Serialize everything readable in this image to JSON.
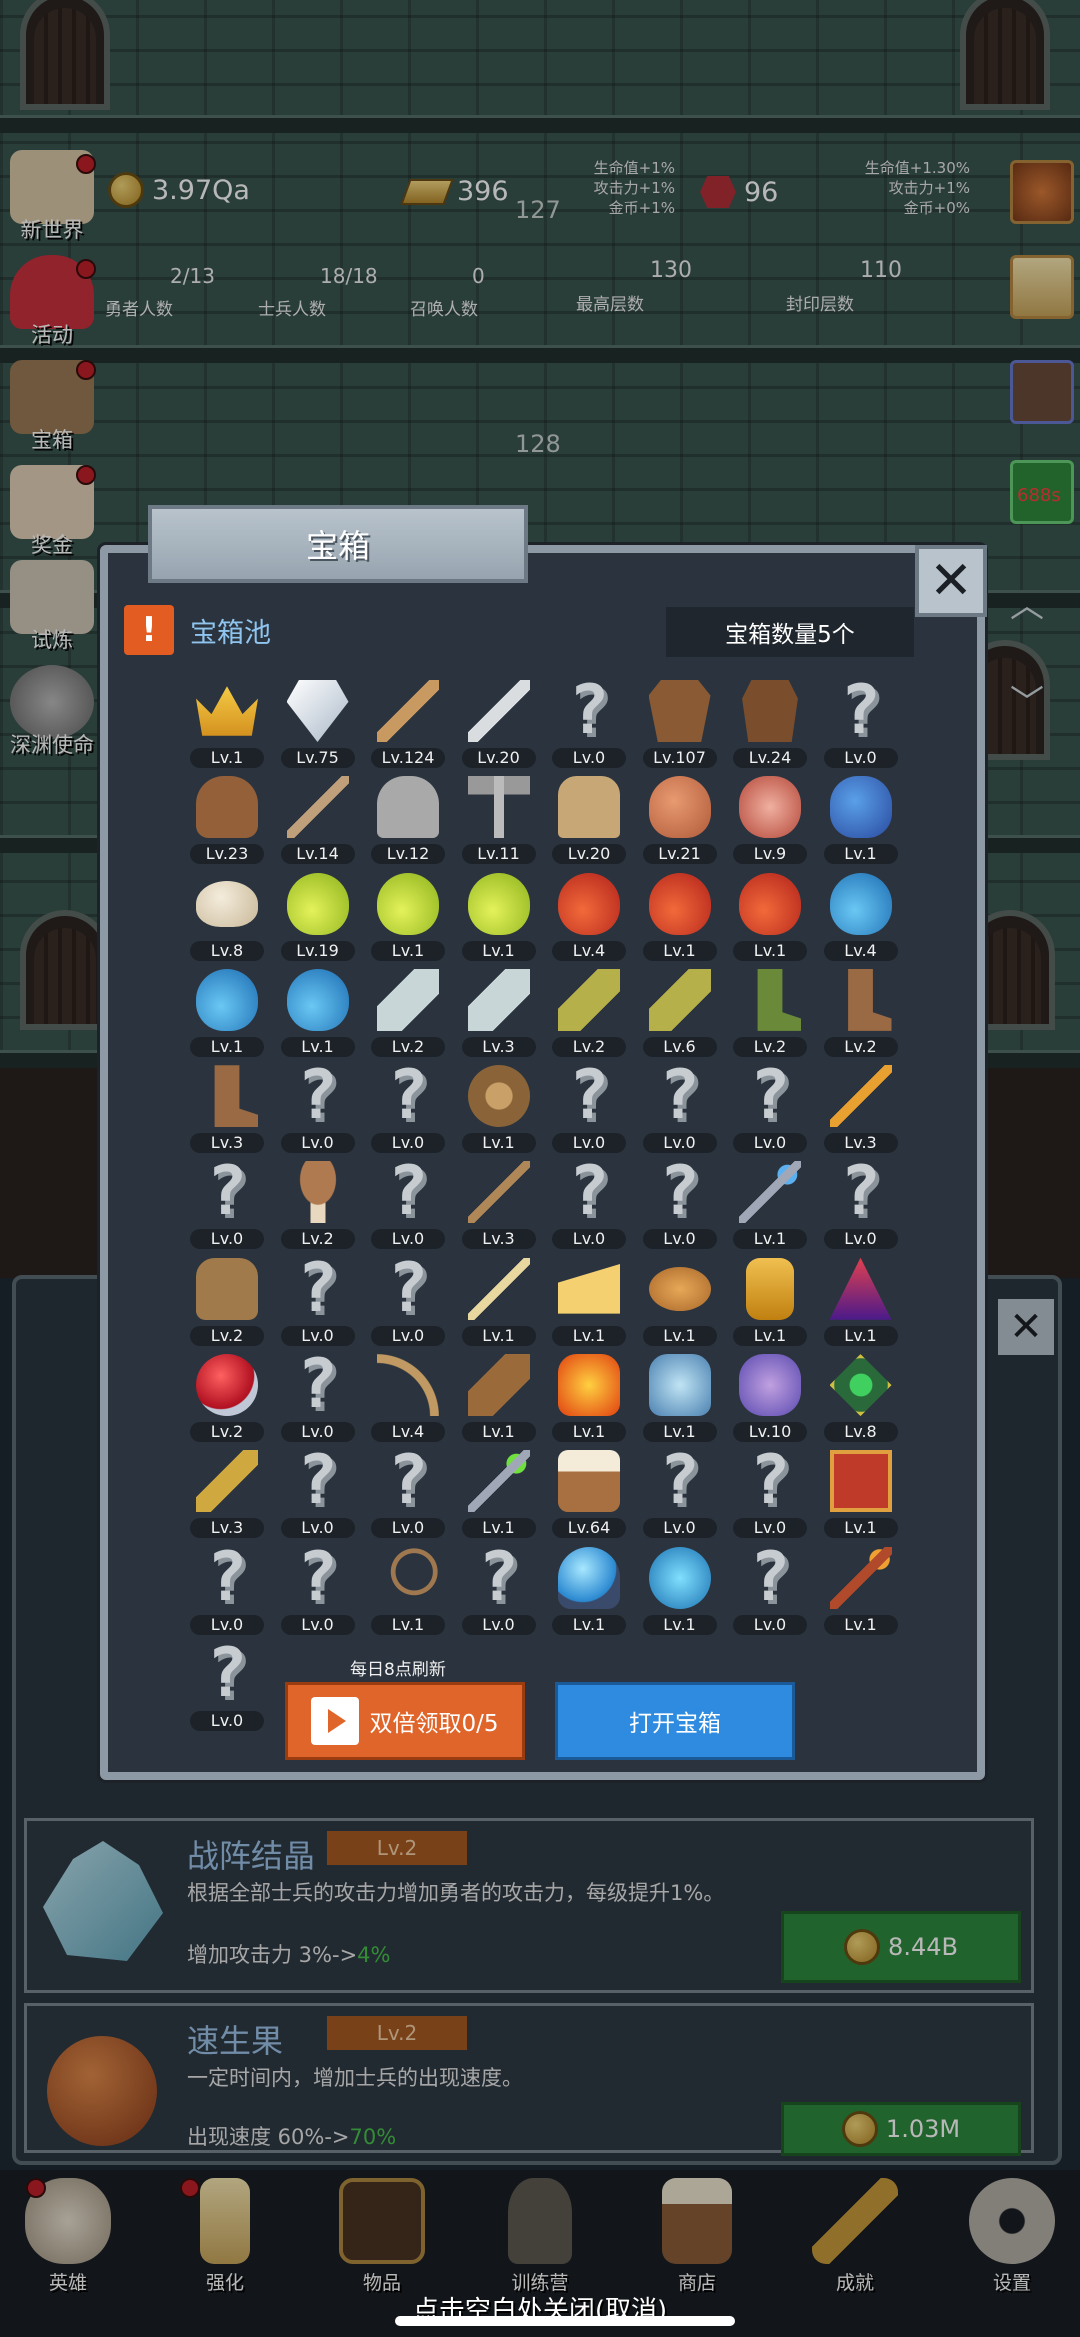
{
  "hud": {
    "gold": "3.97Qa",
    "bars": "396",
    "gems": "96",
    "mid_num": "127",
    "floor_num": "128",
    "timer": "688s",
    "buff_left": [
      "生命值+1%",
      "攻击力+1%",
      "金币+1%"
    ],
    "buff_right": [
      "生命值+1.30%",
      "攻击力+1%",
      "金币+0%"
    ],
    "stats": [
      {
        "value": "2/13",
        "label": "勇者人数"
      },
      {
        "value": "18/18",
        "label": "士兵人数"
      },
      {
        "value": "0",
        "label": "召唤人数"
      },
      {
        "value": "130",
        "label": "最高层数"
      },
      {
        "value": "110",
        "label": "封印层数"
      }
    ]
  },
  "side_menu": [
    "新世界",
    "活动",
    "宝箱",
    "奖金",
    "试炼",
    "深渊使命"
  ],
  "modal": {
    "title": "宝箱",
    "pool_title": "宝箱池",
    "chest_count": "宝箱数量5个",
    "refresh_note": "每日8点刷新",
    "double_claim": "双倍领取0/5",
    "open_chest": "打开宝箱",
    "items": [
      {
        "icon": "crown",
        "lv": "Lv.1"
      },
      {
        "icon": "diamond",
        "lv": "Lv.75"
      },
      {
        "icon": "wooden-sword",
        "lv": "Lv.124"
      },
      {
        "icon": "iron-sword",
        "lv": "Lv.20"
      },
      {
        "icon": "unknown",
        "lv": "Lv.0"
      },
      {
        "icon": "leather-armor",
        "lv": "Lv.107"
      },
      {
        "icon": "vest",
        "lv": "Lv.24"
      },
      {
        "icon": "unknown",
        "lv": "Lv.0"
      },
      {
        "icon": "leather-helmet",
        "lv": "Lv.23"
      },
      {
        "icon": "dagger",
        "lv": "Lv.14"
      },
      {
        "icon": "knight-helmet",
        "lv": "Lv.12"
      },
      {
        "icon": "hammer",
        "lv": "Lv.11"
      },
      {
        "icon": "great-helm",
        "lv": "Lv.20"
      },
      {
        "icon": "ham",
        "lv": "Lv.21"
      },
      {
        "icon": "steak",
        "lv": "Lv.9"
      },
      {
        "icon": "blue-sack",
        "lv": "Lv.1"
      },
      {
        "icon": "bread",
        "lv": "Lv.8"
      },
      {
        "icon": "yellow-potion",
        "lv": "Lv.19"
      },
      {
        "icon": "yellow-potion",
        "lv": "Lv.1"
      },
      {
        "icon": "yellow-potion",
        "lv": "Lv.1"
      },
      {
        "icon": "red-potion",
        "lv": "Lv.4"
      },
      {
        "icon": "red-potion",
        "lv": "Lv.1"
      },
      {
        "icon": "red-potion",
        "lv": "Lv.1"
      },
      {
        "icon": "blue-potion",
        "lv": "Lv.4"
      },
      {
        "icon": "blue-potion",
        "lv": "Lv.1"
      },
      {
        "icon": "blue-potion",
        "lv": "Lv.1"
      },
      {
        "icon": "bottle",
        "lv": "Lv.2"
      },
      {
        "icon": "bottle",
        "lv": "Lv.3"
      },
      {
        "icon": "wine-bottle",
        "lv": "Lv.2"
      },
      {
        "icon": "wine-bottle",
        "lv": "Lv.6"
      },
      {
        "icon": "winged-boot",
        "lv": "Lv.2"
      },
      {
        "icon": "boot",
        "lv": "Lv.2"
      },
      {
        "icon": "boot",
        "lv": "Lv.3"
      },
      {
        "icon": "unknown",
        "lv": "Lv.0"
      },
      {
        "icon": "unknown",
        "lv": "Lv.0"
      },
      {
        "icon": "round-shield",
        "lv": "Lv.1"
      },
      {
        "icon": "unknown",
        "lv": "Lv.0"
      },
      {
        "icon": "unknown",
        "lv": "Lv.0"
      },
      {
        "icon": "unknown",
        "lv": "Lv.0"
      },
      {
        "icon": "torch",
        "lv": "Lv.3"
      },
      {
        "icon": "unknown",
        "lv": "Lv.0"
      },
      {
        "icon": "mushroom",
        "lv": "Lv.2"
      },
      {
        "icon": "unknown",
        "lv": "Lv.0"
      },
      {
        "icon": "staff",
        "lv": "Lv.3"
      },
      {
        "icon": "unknown",
        "lv": "Lv.0"
      },
      {
        "icon": "unknown",
        "lv": "Lv.0"
      },
      {
        "icon": "blue-wand",
        "lv": "Lv.1"
      },
      {
        "icon": "unknown",
        "lv": "Lv.0"
      },
      {
        "icon": "backpack",
        "lv": "Lv.2"
      },
      {
        "icon": "unknown",
        "lv": "Lv.0"
      },
      {
        "icon": "unknown",
        "lv": "Lv.0"
      },
      {
        "icon": "broom",
        "lv": "Lv.1"
      },
      {
        "icon": "cheese",
        "lv": "Lv.1"
      },
      {
        "icon": "pie",
        "lv": "Lv.1"
      },
      {
        "icon": "honey-jar",
        "lv": "Lv.1"
      },
      {
        "icon": "crystal-pyramid",
        "lv": "Lv.1"
      },
      {
        "icon": "red-orb",
        "lv": "Lv.2"
      },
      {
        "icon": "unknown",
        "lv": "Lv.0"
      },
      {
        "icon": "bow",
        "lv": "Lv.4"
      },
      {
        "icon": "quiver",
        "lv": "Lv.1"
      },
      {
        "icon": "fire-glove",
        "lv": "Lv.1"
      },
      {
        "icon": "ice-glove",
        "lv": "Lv.1"
      },
      {
        "icon": "tentacle-glove",
        "lv": "Lv.10"
      },
      {
        "icon": "rune-amulet",
        "lv": "Lv.8"
      },
      {
        "icon": "lantern-rod",
        "lv": "Lv.3"
      },
      {
        "icon": "unknown",
        "lv": "Lv.0"
      },
      {
        "icon": "unknown",
        "lv": "Lv.0"
      },
      {
        "icon": "green-wand",
        "lv": "Lv.1"
      },
      {
        "icon": "beer-mug",
        "lv": "Lv.64"
      },
      {
        "icon": "unknown",
        "lv": "Lv.0"
      },
      {
        "icon": "unknown",
        "lv": "Lv.0"
      },
      {
        "icon": "red-book",
        "lv": "Lv.1"
      },
      {
        "icon": "unknown",
        "lv": "Lv.0"
      },
      {
        "icon": "unknown",
        "lv": "Lv.0"
      },
      {
        "icon": "whip",
        "lv": "Lv.1"
      },
      {
        "icon": "unknown",
        "lv": "Lv.0"
      },
      {
        "icon": "crystal-ball",
        "lv": "Lv.1"
      },
      {
        "icon": "rune-disc",
        "lv": "Lv.1"
      },
      {
        "icon": "unknown",
        "lv": "Lv.0"
      },
      {
        "icon": "flame-spear",
        "lv": "Lv.1"
      },
      {
        "icon": "unknown",
        "lv": "Lv.0"
      }
    ]
  },
  "upgrades": [
    {
      "title": "战阵结晶",
      "level": "Lv.2",
      "desc": "根据全部士兵的攻击力增加勇者的攻击力，每级提升1%。",
      "effect": "增加攻击力 3%->",
      "effect_up": "4%",
      "cost": "8.44B"
    },
    {
      "title": "速生果",
      "level": "Lv.2",
      "desc": "一定时间内，增加士兵的出现速度。",
      "effect": "出现速度 60%->",
      "effect_up": "70%",
      "cost": "1.03M"
    }
  ],
  "bottom_nav": [
    "英雄",
    "强化",
    "物品",
    "训练营",
    "商店",
    "成就",
    "设置"
  ],
  "hint": "点击空白处关闭(取消)",
  "colors": {
    "accent_blue": "#2e8be0",
    "accent_orange": "#e0652a",
    "buy_green": "#2e8a3d",
    "pool_title": "#8fc4ef"
  }
}
